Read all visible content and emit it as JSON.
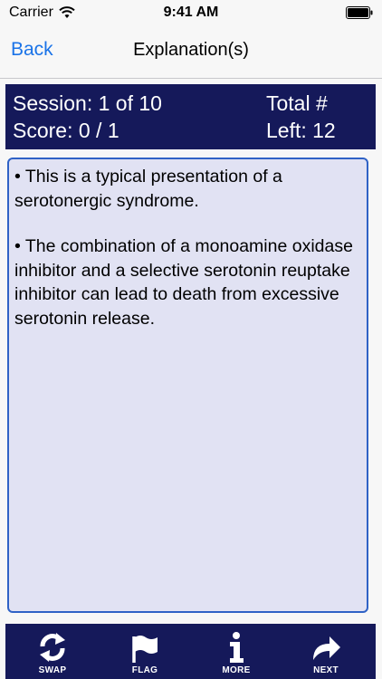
{
  "status_bar": {
    "carrier": "Carrier",
    "time": "9:41 AM"
  },
  "nav": {
    "back_label": "Back",
    "title": "Explanation(s)"
  },
  "header": {
    "session": "Session: 1 of 10",
    "score": "Score: 0 / 1",
    "total": "Total #",
    "left": "Left: 12"
  },
  "explanation": {
    "paragraphs": [
      "• This is a typical presentation of a serotonergic syndrome.",
      "•  The combination of a monoamine oxidase inhibitor and a selective serotonin reuptake inhibitor can lead to death from excessive serotonin release."
    ]
  },
  "toolbar": {
    "swap_label": "SWAP",
    "flag_label": "FLAG",
    "more_label": "MORE",
    "next_label": "NEXT"
  },
  "icons": {
    "swap": "swap-icon",
    "flag": "flag-icon",
    "more": "info-icon",
    "next": "next-arrow-icon",
    "wifi": "wifi-icon",
    "battery": "battery-icon"
  },
  "colors": {
    "accent": "#1a73e8",
    "panel": "#15195a",
    "content_bg": "#e1e2f3",
    "content_border": "#2f62c6"
  }
}
